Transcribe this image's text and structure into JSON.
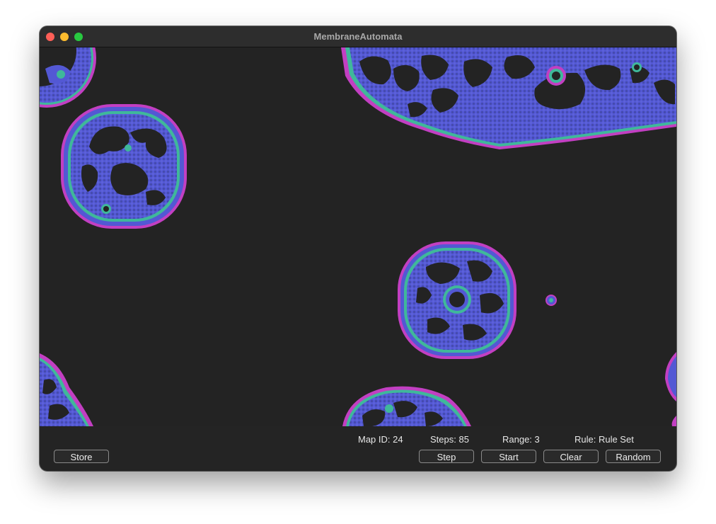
{
  "window": {
    "title": "MembraneAutomata"
  },
  "simulation": {
    "colors": {
      "background": "#232323",
      "membrane": "#c23fc2",
      "inner_ring": "#3fb89a",
      "fill": "#5358d4",
      "dark_fill": "#3a3f8f"
    }
  },
  "status": {
    "map_id": "Map ID: 24",
    "steps": "Steps: 85",
    "range": "Range: 3",
    "rule": "Rule: Rule Set"
  },
  "buttons": {
    "store": "Store",
    "step": "Step",
    "start": "Start",
    "clear": "Clear",
    "random": "Random"
  }
}
